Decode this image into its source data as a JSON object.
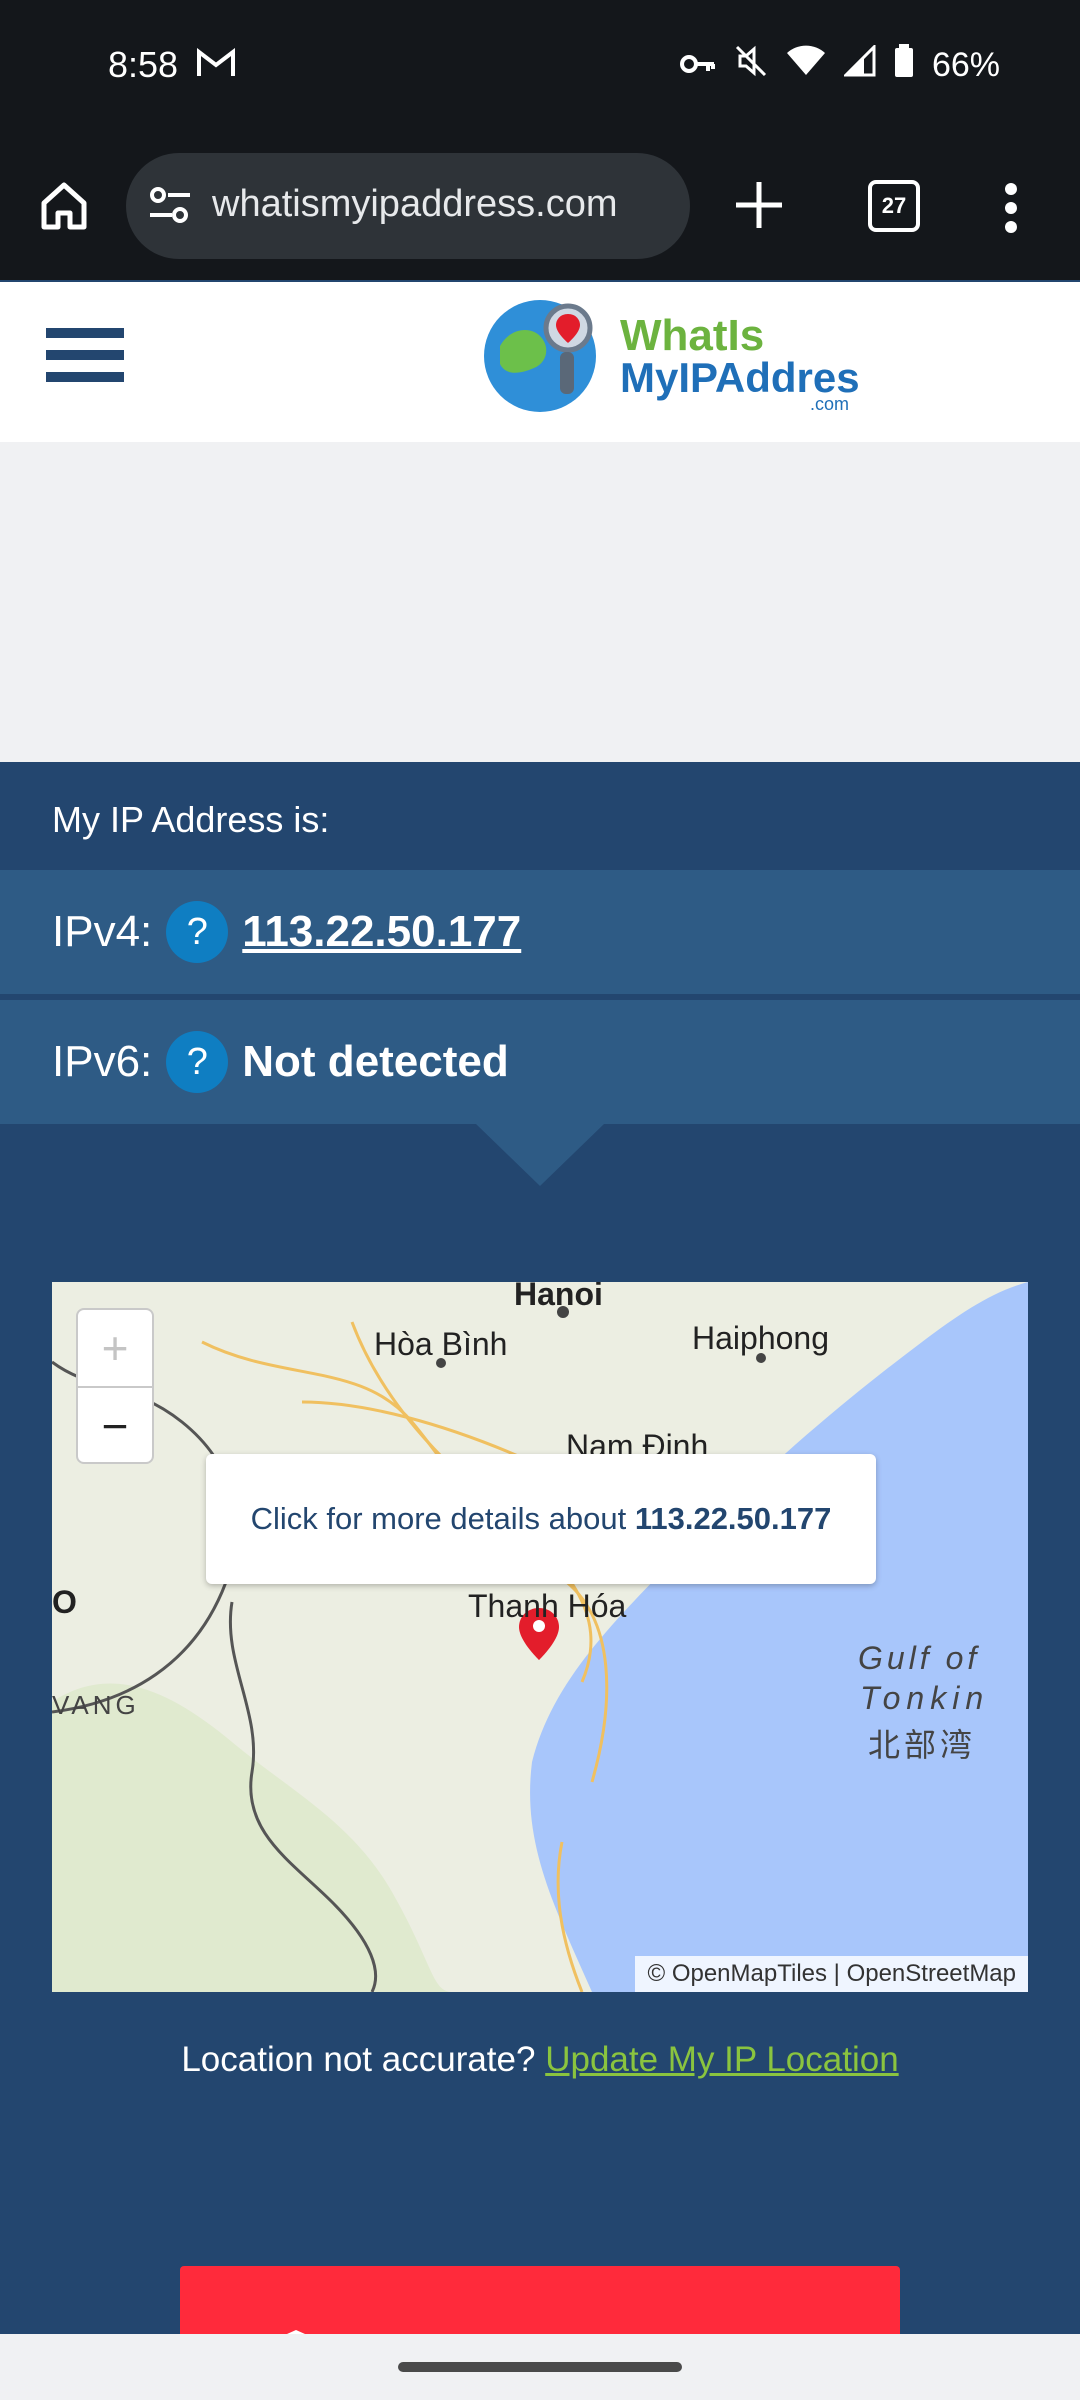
{
  "status": {
    "time": "8:58",
    "battery": "66%"
  },
  "browser": {
    "url": "whatismyipaddress.com",
    "tab_count": "27"
  },
  "site": {
    "logo_line1": "WhatIs",
    "logo_line2": "MyIPAddress",
    "logo_suffix": ".com"
  },
  "ip": {
    "label": "My IP Address is:",
    "ipv4_label": "IPv4:",
    "ipv4_value": "113.22.50.177",
    "ipv6_label": "IPv6:",
    "ipv6_value": "Not detected",
    "help_glyph": "?"
  },
  "map": {
    "zoom_in": "+",
    "zoom_out": "−",
    "popup_text": "Click for more details about ",
    "popup_ip": "113.22.50.177",
    "labels": {
      "hanoi": "Hanoi",
      "hoabinh": "Hòa Bình",
      "haiphong": "Haiphong",
      "namdinh": "Nam Định",
      "thanhhoa": "Thanh Hóa",
      "gulf1": "Gulf of",
      "gulf2": "Tonkin",
      "gulf3": "北部湾",
      "o": "O",
      "vang": "VANG"
    },
    "attribution": "© OpenMapTiles | OpenStreetMap"
  },
  "location": {
    "question": "Location not accurate? ",
    "link": "Update My IP Location"
  },
  "colors": {
    "navy": "#23466f",
    "row": "#2e5b85",
    "help": "#0f7ec2",
    "link_green": "#8ac43f",
    "cta_red": "#ff2a3b"
  }
}
